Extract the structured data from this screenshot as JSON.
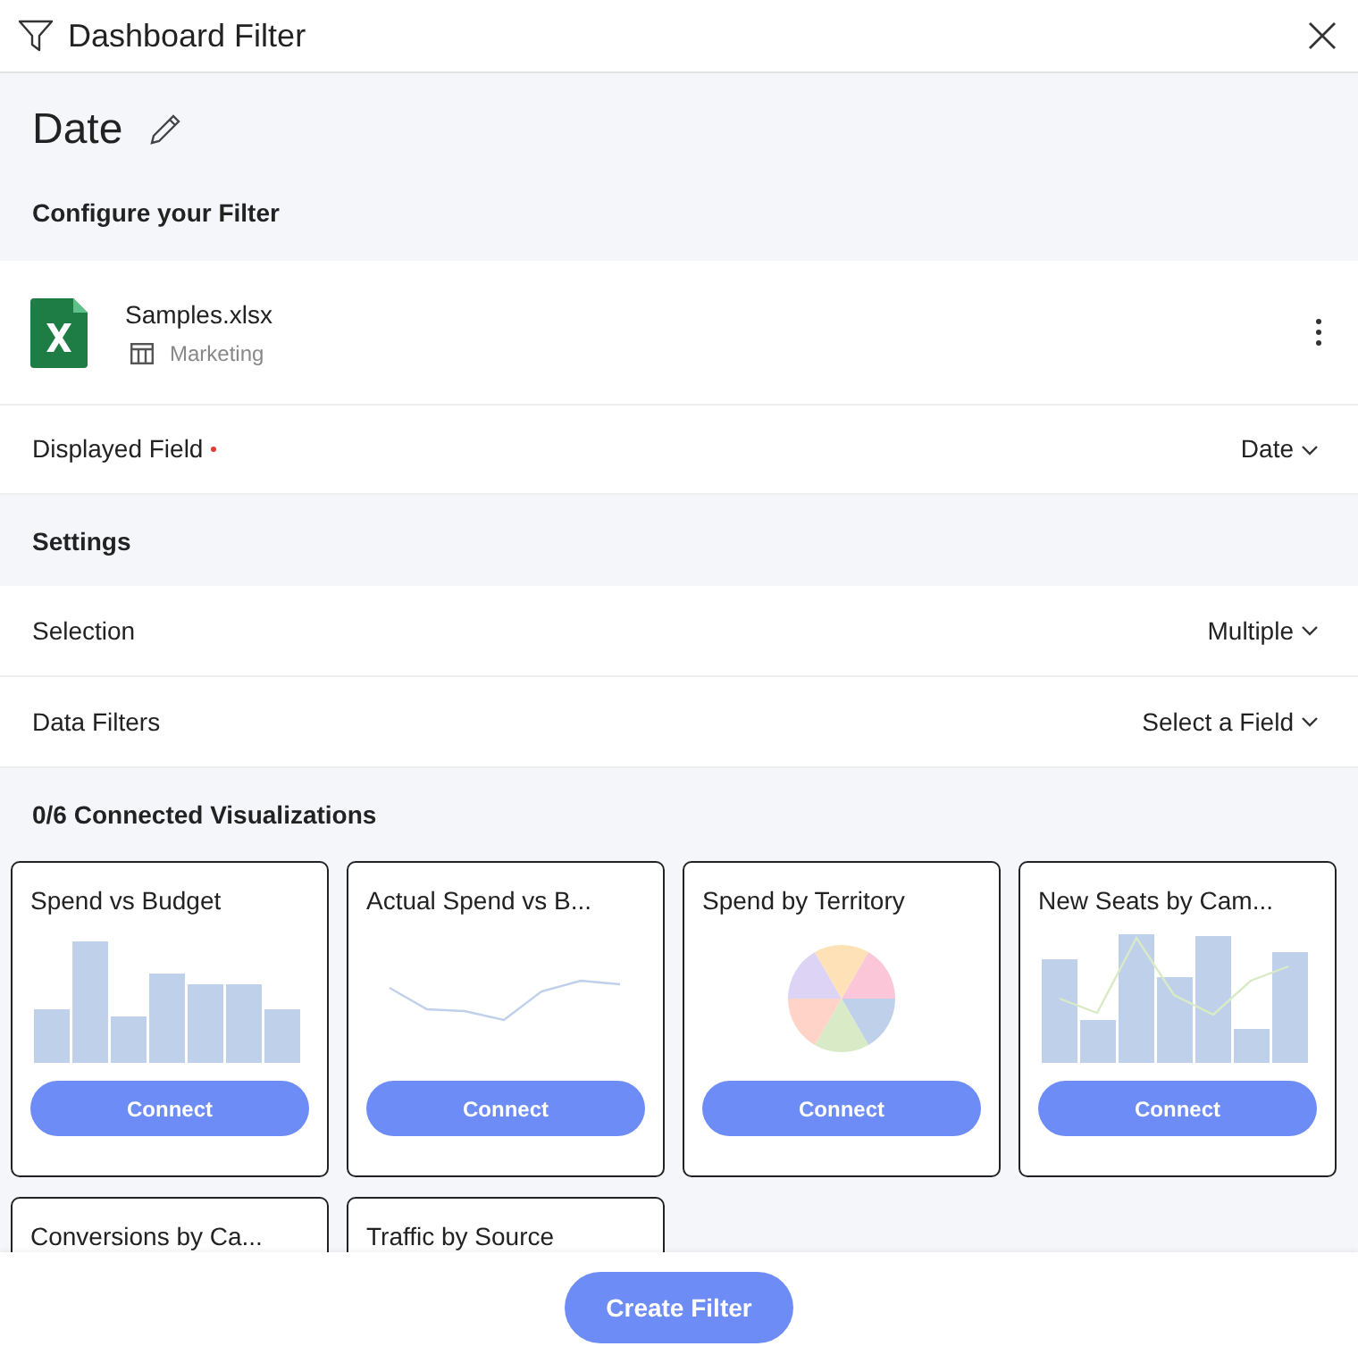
{
  "window": {
    "title": "Dashboard Filter"
  },
  "filter": {
    "name": "Date",
    "section_title": "Configure your Filter"
  },
  "source": {
    "file": "Samples.xlsx",
    "sheet": "Marketing"
  },
  "displayed_field": {
    "label": "Displayed Field",
    "required": true,
    "value": "Date"
  },
  "settings": {
    "title": "Settings",
    "rows": [
      {
        "label": "Selection",
        "value": "Multiple"
      },
      {
        "label": "Data Filters",
        "value": "Select a Field"
      }
    ]
  },
  "visualizations": {
    "title": "0/6 Connected Visualizations",
    "cards": [
      {
        "title": "Spend vs Budget",
        "kind": "bar",
        "button": "Connect"
      },
      {
        "title": "Actual Spend vs B...",
        "kind": "line",
        "button": "Connect"
      },
      {
        "title": "Spend by Territory",
        "kind": "pie",
        "button": "Connect"
      },
      {
        "title": "New Seats by Cam...",
        "kind": "combo",
        "button": "Connect"
      },
      {
        "title": "Conversions by Ca...",
        "kind": "none"
      },
      {
        "title": "Traffic by Source",
        "kind": "none"
      }
    ]
  },
  "footer": {
    "button": "Create Filter"
  }
}
